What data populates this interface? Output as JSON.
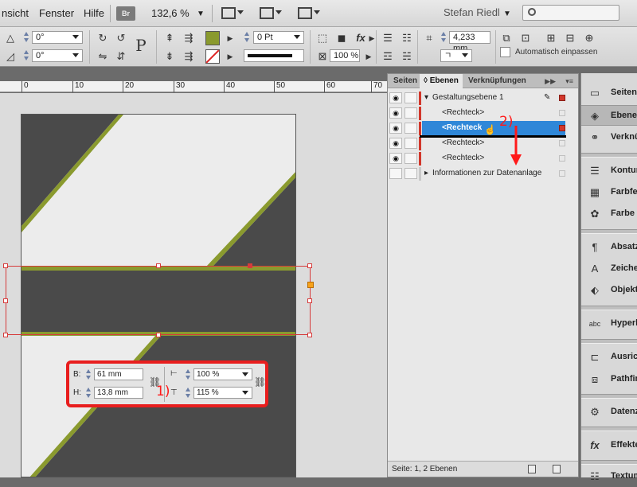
{
  "menubar": {
    "items": [
      "nsicht",
      "Fenster",
      "Hilfe"
    ],
    "br_badge": "Br",
    "zoom": "132,6 %",
    "user": "Stefan Riedl",
    "search_placeholder": ""
  },
  "control": {
    "angle1": "0°",
    "angle2": "0°",
    "stroke_weight": "0 Pt",
    "scale_percent": "100 %",
    "offset_value": "4,233 mm",
    "auto_fit_label": "Automatisch einpassen",
    "paragraph_glyph": "P",
    "fx_label": "fx"
  },
  "ruler": {
    "ticks": [
      "0",
      "10",
      "20",
      "30",
      "40",
      "50",
      "60",
      "70"
    ]
  },
  "colors": {
    "dark_shape": "#4a4a4a",
    "green_stripe": "#8a9a2e",
    "selection_red": "#d63b3b",
    "accent_blue": "#2f87d8"
  },
  "sizebox": {
    "width_label": "B:",
    "width_value": "61 mm",
    "height_label": "H:",
    "height_value": "13,8 mm",
    "scale_x": "100 %",
    "scale_y": "115 %"
  },
  "annotations": {
    "step1": "1)",
    "step2": "2)"
  },
  "layers_panel": {
    "tabs": [
      "Seiten",
      "Ebenen",
      "Verknüpfungen"
    ],
    "active_tab": "Ebenen",
    "rows": [
      {
        "name": "Gestaltungsebene 1",
        "kind": "layer"
      },
      {
        "name": "<Rechteck>",
        "kind": "item"
      },
      {
        "name": "<Rechteck>",
        "kind": "item-selected"
      },
      {
        "name": "<Rechteck>",
        "kind": "item"
      },
      {
        "name": "<Rechteck>",
        "kind": "item"
      },
      {
        "name": "Informationen zur Datenanlage",
        "kind": "layer"
      }
    ],
    "footer": "Seite: 1, 2 Ebenen"
  },
  "dock": {
    "items": [
      "Seiten",
      "Ebenen",
      "Verknü",
      "Kontur",
      "Farbfel",
      "Farbe",
      "Absatzf",
      "Zeiche",
      "Objekt",
      "Hyperli",
      "Ausrich",
      "Pathfin",
      "Datenz",
      "Effekte",
      "Textum"
    ]
  }
}
